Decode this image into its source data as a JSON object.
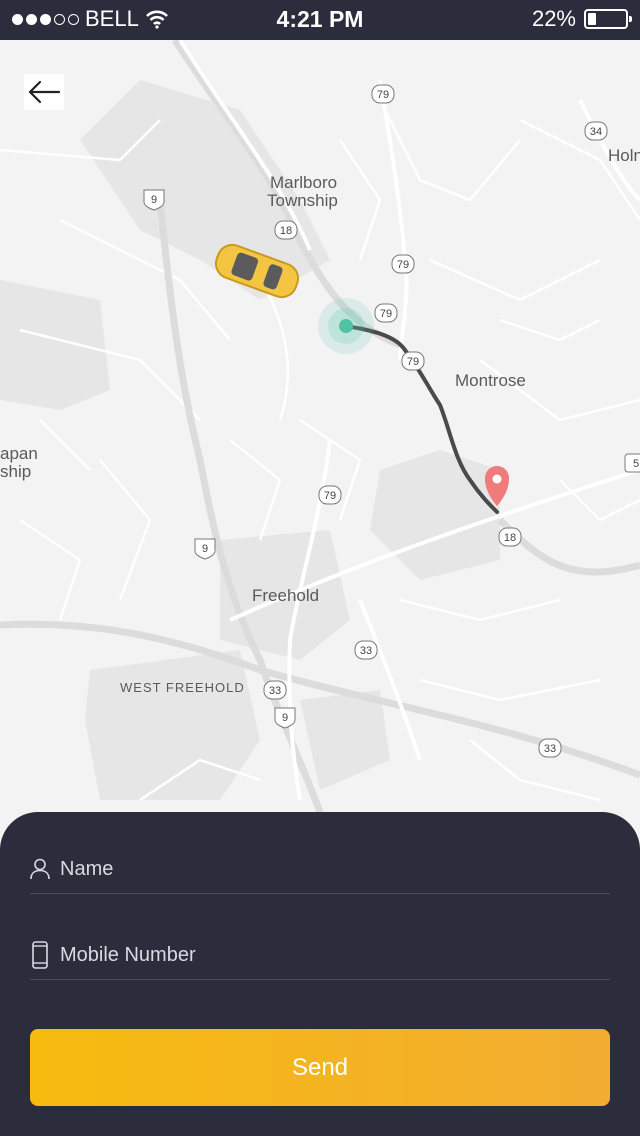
{
  "status_bar": {
    "carrier": "BELL",
    "time": "4:21 PM",
    "battery": "22%",
    "battery_level": 0.22,
    "signal_bars": 3
  },
  "map": {
    "places": {
      "marlboro_1": "Marlboro",
      "marlboro_2": "Township",
      "montrose": "Montrose",
      "freehold": "Freehold",
      "west_freehold": "WEST FREEHOLD",
      "holm": "Holn",
      "japan_1": "apan",
      "japan_2": "ship"
    },
    "routes": {
      "r79a": "79",
      "r79b": "79",
      "r79c": "79",
      "r79d": "79",
      "r79e": "79",
      "r34": "34",
      "r9a": "9",
      "r9b": "9",
      "r9c": "9",
      "r18a": "18",
      "r18b": "18",
      "r33a": "33",
      "r33b": "33",
      "r33c": "33",
      "r5": "5"
    }
  },
  "icons": {
    "back": "arrow-left-icon",
    "user": "user-icon",
    "phone": "mobile-phone-icon",
    "destination": "map-pin-icon",
    "taxi": "taxi-car-icon"
  },
  "form": {
    "name_placeholder": "Name",
    "mobile_placeholder": "Mobile Number",
    "send_label": "Send"
  },
  "colors": {
    "accent": "#f7bb0f",
    "sheet": "#2b2d3d",
    "origin": "#4fc3a6",
    "pin": "#f07b7b"
  }
}
